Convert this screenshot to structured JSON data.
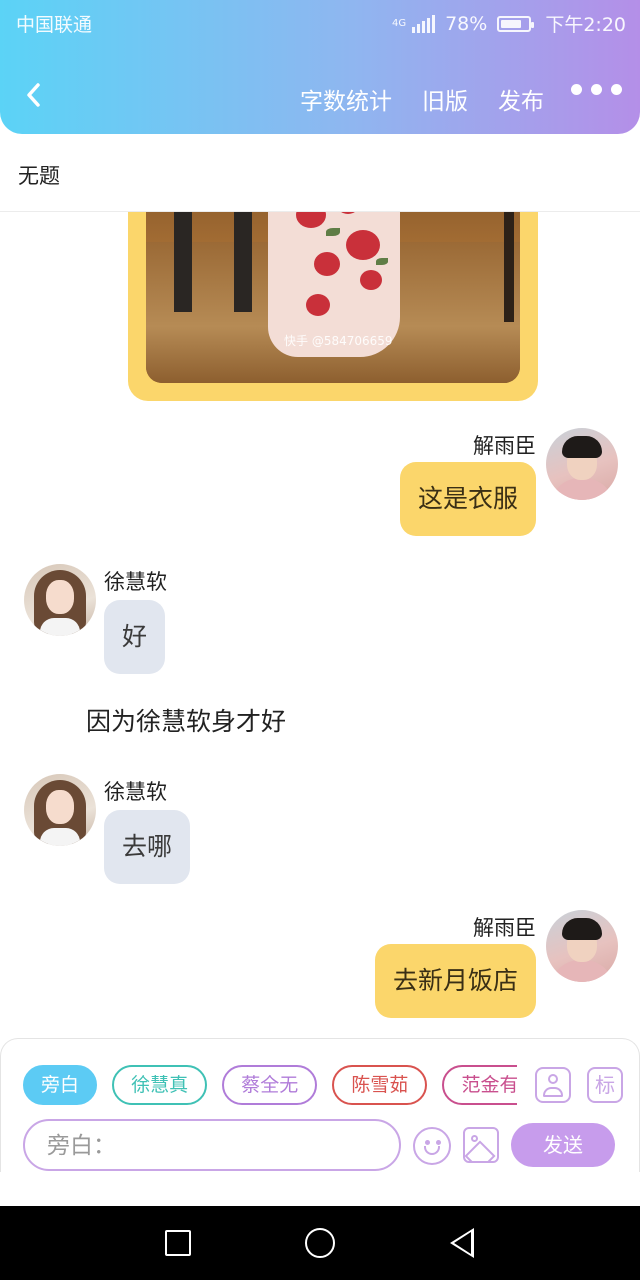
{
  "status_bar": {
    "carrier": "中国联通",
    "network": "4G",
    "battery": "78%",
    "battery_level": 0.78,
    "time": "下午2:20"
  },
  "nav": {
    "back_icon": "chevron-left-icon",
    "actions": [
      "字数统计",
      "旧版",
      "发布"
    ],
    "more_icon": "more-horizontal-icon"
  },
  "document": {
    "title": "无题"
  },
  "photo": {
    "watermark": "快手 @584706659"
  },
  "messages": [
    {
      "side": "right",
      "name": "解雨臣",
      "text": "这是衣服"
    },
    {
      "side": "left",
      "name": "徐慧软",
      "text": "好"
    },
    {
      "type": "narration",
      "text": "因为徐慧软身才好"
    },
    {
      "side": "left",
      "name": "徐慧软",
      "text": "去哪"
    },
    {
      "side": "right",
      "name": "解雨臣",
      "text": "去新月饭店"
    }
  ],
  "composer": {
    "roles": [
      {
        "label": "旁白",
        "color": "#5ccbf4",
        "active": true
      },
      {
        "label": "徐慧真",
        "color": "#3fc1b5",
        "active": false
      },
      {
        "label": "蔡全无",
        "color": "#b07cd9",
        "active": false
      },
      {
        "label": "陈雪茹",
        "color": "#d9534f",
        "active": false
      },
      {
        "label": "范金有",
        "color": "#c94f8e",
        "active": false
      }
    ],
    "contact_icon": "contact-card-icon",
    "mark_label": "标",
    "input_placeholder": "旁白：",
    "emoji_icon": "emoji-icon",
    "image_icon": "image-icon",
    "send_label": "发送"
  }
}
